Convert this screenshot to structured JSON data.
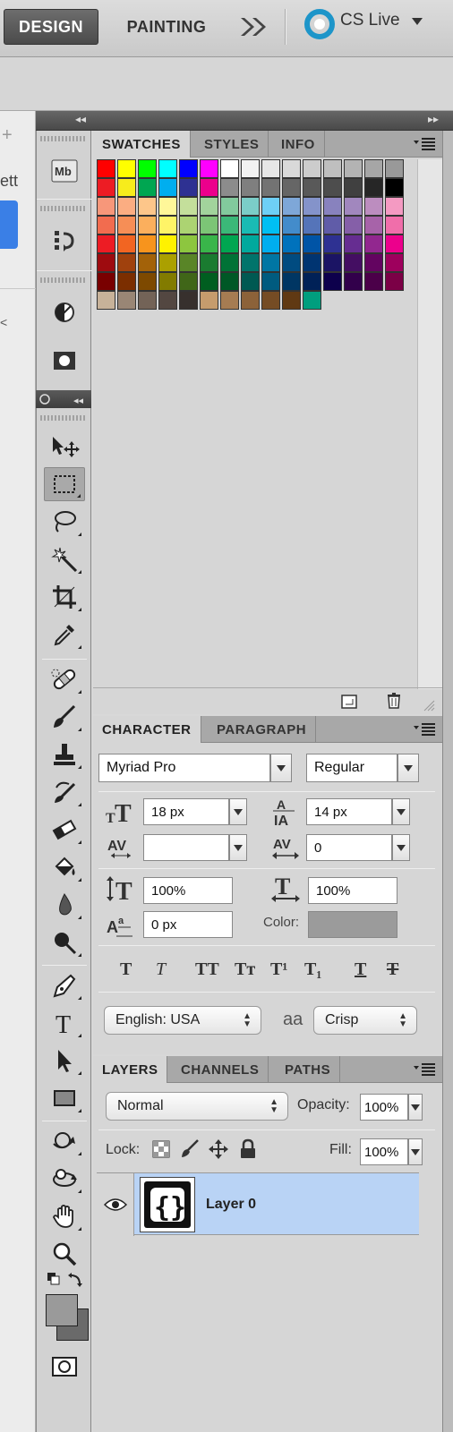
{
  "workspaces": {
    "design": "DESIGN",
    "painting": "PAINTING",
    "cs_live": "CS Live"
  },
  "doc_fragment": {
    "text": "ett",
    "plus": "+",
    "arrow": "<"
  },
  "swatches": {
    "tabs": [
      "SWATCHES",
      "STYLES",
      "INFO"
    ],
    "colors": [
      [
        "#ff0000",
        "#ffff00",
        "#00ff00",
        "#00ffff",
        "#0000ff",
        "#ff00ff",
        "#ffffff",
        "#f2f2f2",
        "#e6e6e6",
        "#d9d9d9",
        "#cccccc",
        "#bfbfbf",
        "#b3b3b3",
        "#a6a6a6",
        "#999999"
      ],
      [
        "#ed1c24",
        "#f7ec1c",
        "#00a651",
        "#00aeef",
        "#2e3192",
        "#ec008c",
        "#8c8c8c",
        "#7f7f7f",
        "#737373",
        "#666666",
        "#595959",
        "#4d4d4d",
        "#404040",
        "#262626",
        "#000000"
      ],
      [
        "#f7977a",
        "#fbad82",
        "#fdc68a",
        "#fff799",
        "#c4df9b",
        "#a2d39c",
        "#82ca9d",
        "#7bcdc8",
        "#6ecff6",
        "#7ea7d8",
        "#8493ca",
        "#8882be",
        "#a187be",
        "#bc8dbf",
        "#f49ac2"
      ],
      [
        "#f26c4f",
        "#f68e56",
        "#fbaf5d",
        "#fff467",
        "#acd372",
        "#7cc576",
        "#3bb878",
        "#1abbb4",
        "#00bff3",
        "#438ccb",
        "#5574b9",
        "#605ca8",
        "#855fa8",
        "#a763a9",
        "#f06eaa"
      ],
      [
        "#ed1c24",
        "#f26522",
        "#f7941d",
        "#fff200",
        "#8dc63f",
        "#39b54a",
        "#00a651",
        "#00a99d",
        "#00aeef",
        "#0072bc",
        "#0054a6",
        "#2e3192",
        "#662d91",
        "#92278f",
        "#ec008c"
      ],
      [
        "#9e0b0f",
        "#a0410d",
        "#a36209",
        "#aba000",
        "#598527",
        "#1a7b30",
        "#007236",
        "#00746b",
        "#0076a3",
        "#004b80",
        "#003471",
        "#1b1464",
        "#440e62",
        "#630460",
        "#9e005d"
      ],
      [
        "#790000",
        "#7b2e00",
        "#7d4900",
        "#827b00",
        "#406618",
        "#005e20",
        "#005826",
        "#005952",
        "#005b7f",
        "#003663",
        "#002157",
        "#0d004c",
        "#32004b",
        "#4b0049",
        "#7b0046"
      ],
      [
        "#c7b299",
        "#998675",
        "#736357",
        "#534741",
        "#37302d",
        "#c69c6d",
        "#a67c52",
        "#8c6239",
        "#754c24",
        "#603913",
        "#009e7e"
      ]
    ]
  },
  "character": {
    "tabs": [
      "CHARACTER",
      "PARAGRAPH"
    ],
    "font_family": "Myriad Pro",
    "font_style": "Regular",
    "font_size": "18 px",
    "leading": "14 px",
    "kerning": "",
    "tracking": "0",
    "vertical_scale": "100%",
    "horizontal_scale": "100%",
    "baseline_shift": "0 px",
    "color_label": "Color:",
    "color_value": "#9b9b9b",
    "style_buttons": [
      "T",
      "T",
      "TT",
      "Tт",
      "T¹",
      "T₁",
      "T",
      "T"
    ],
    "language": "English: USA",
    "aa_label": "aa",
    "antialias": "Crisp"
  },
  "layers": {
    "tabs": [
      "LAYERS",
      "CHANNELS",
      "PATHS"
    ],
    "blend_mode": "Normal",
    "opacity_label": "Opacity:",
    "opacity": "100%",
    "lock_label": "Lock:",
    "fill_label": "Fill:",
    "fill": "100%",
    "items": [
      {
        "name": "Layer 0",
        "visible": true,
        "selected": true
      }
    ]
  },
  "colors": {
    "foreground": "#8a8a8a",
    "background": "#6a6a6a",
    "selection": "#b9d3f5",
    "cs_live": "#1d95c9"
  }
}
